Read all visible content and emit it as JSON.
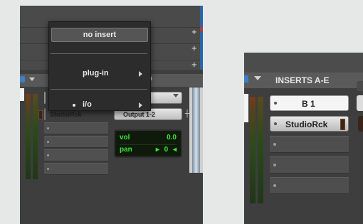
{
  "left_panel": {
    "popup_menu": {
      "items": [
        {
          "label": "no insert",
          "selected": true
        },
        {
          "label": "plug-in",
          "submenu": true
        },
        {
          "label": "i/o",
          "submenu": true,
          "bullet": true
        }
      ]
    },
    "header_partial_text": "O",
    "inserts": {
      "slot1_label": "",
      "slot2_label": "StudioRck"
    },
    "io": {
      "input_label": "",
      "output_label": "Output 1-2"
    },
    "vol_pan": {
      "vol_label": "vol",
      "vol_value": "0.0",
      "pan_label": "pan",
      "pan_value": "0",
      "pan_arrow_left": "▸",
      "pan_arrow_right": "◂"
    },
    "tracklist_buttons": [
      "+",
      "+",
      "+"
    ]
  },
  "right_panel": {
    "header_title": "INSERTS A-E",
    "inserts": [
      {
        "label": "B 1",
        "style": "white"
      },
      {
        "label": "StudioRck",
        "style": "grey"
      }
    ]
  },
  "colors": {
    "panel_bg": "#3e3e3e",
    "lcd_text": "#3fe43b",
    "accent_blue": "#3d7fc9"
  }
}
